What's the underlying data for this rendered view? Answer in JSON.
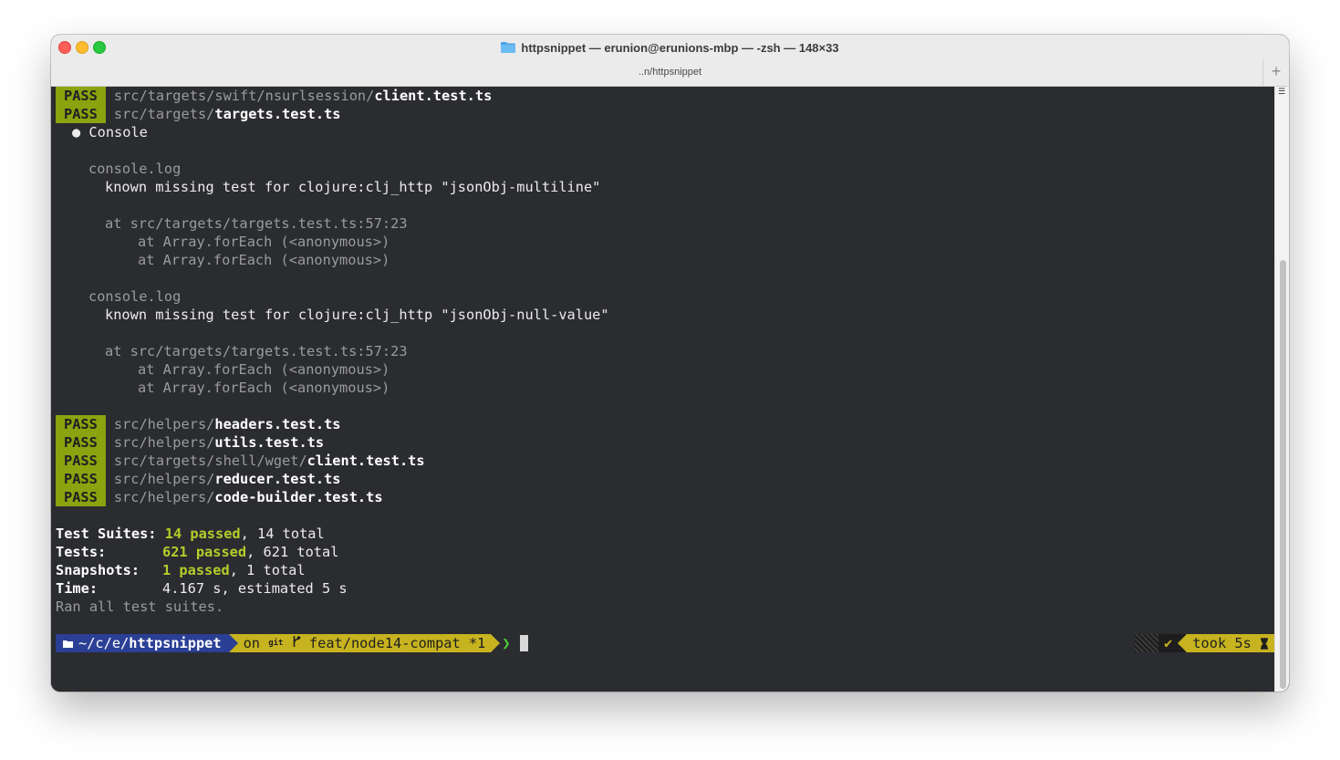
{
  "window": {
    "title": "httpsnippet — erunion@erunions-mbp — -zsh — 148×33",
    "tab_label": "..n/httpsnippet",
    "new_tab_label": "+",
    "folder_icon": "folder-icon"
  },
  "terminal": {
    "pass_label": "PASS",
    "top_results": [
      {
        "dir": "src/targets/swift/nsurlsession/",
        "file": "client.test.ts"
      },
      {
        "dir": "src/targets/",
        "file": "targets.test.ts"
      }
    ],
    "console_header": "● Console",
    "console_logs": [
      {
        "label": "console.log",
        "message": "known missing test for clojure:clj_http \"jsonObj-multiline\"",
        "at": "at src/targets/targets.test.ts:57:23",
        "stack": [
          "at Array.forEach (<anonymous>)",
          "at Array.forEach (<anonymous>)"
        ]
      },
      {
        "label": "console.log",
        "message": "known missing test for clojure:clj_http \"jsonObj-null-value\"",
        "at": "at src/targets/targets.test.ts:57:23",
        "stack": [
          "at Array.forEach (<anonymous>)",
          "at Array.forEach (<anonymous>)"
        ]
      }
    ],
    "bottom_results": [
      {
        "dir": "src/helpers/",
        "file": "headers.test.ts"
      },
      {
        "dir": "src/helpers/",
        "file": "utils.test.ts"
      },
      {
        "dir": "src/targets/shell/wget/",
        "file": "client.test.ts"
      },
      {
        "dir": "src/helpers/",
        "file": "reducer.test.ts"
      },
      {
        "dir": "src/helpers/",
        "file": "code-builder.test.ts"
      }
    ],
    "summary": {
      "suites_label": "Test Suites:",
      "suites_passed": "14 passed",
      "suites_total": ", 14 total",
      "tests_label": "Tests:",
      "tests_passed": "621 passed",
      "tests_total": ", 621 total",
      "snapshots_label": "Snapshots:",
      "snapshots_passed": "1 passed",
      "snapshots_total": ", 1 total",
      "time_label": "Time:",
      "time_value": "4.167 s, estimated 5 s",
      "ran": "Ran all test suites."
    },
    "prompt": {
      "dir_icon": "folder-icon",
      "dir_prefix": "~/c/e/",
      "dir_name": "httpsnippet",
      "git_on": "on",
      "git_icon": "git-icon",
      "branch_icon": "branch-icon",
      "branch": "feat/node14-compat *1",
      "chevron": "❯",
      "status_check": "✔",
      "took": "took 5s",
      "hourglass_icon": "hourglass-icon"
    }
  }
}
